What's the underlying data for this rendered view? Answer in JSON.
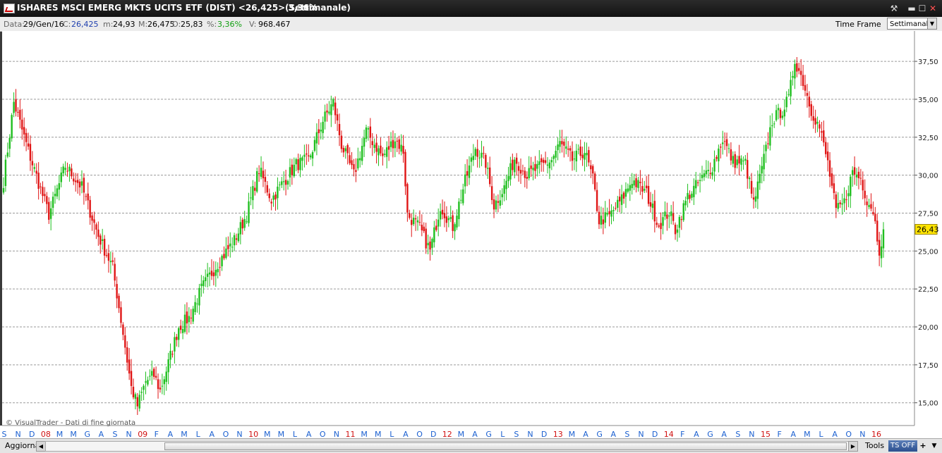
{
  "window": {
    "title": "ISHARES MSCI EMERG MKTS UCITS ETF (DIST) <26,425> 3,36%",
    "timeframe_title": "(Settimanale)",
    "buttons": {
      "tools": "⚒",
      "minimize": "▬",
      "maximize": "☐",
      "close": "✕"
    }
  },
  "info": {
    "data_label": "Data:",
    "data": "29/Gen/16",
    "close_label": "C:",
    "close": "26,425",
    "min_label": "m:",
    "min": "24,93",
    "max_label": "M:",
    "max": "26,475",
    "open_label": "O:",
    "open": "25,83",
    "pct_label": "%:",
    "pct": "3,36%",
    "vol_label": "V:",
    "vol": "968.467",
    "timeframe_label": "Time Frame",
    "timeframe_value": "Settimanale"
  },
  "colors": {
    "up": "#1fbf1f",
    "down": "#e01515",
    "background": "#ffffff",
    "grid": "#9a9a9a",
    "axis_month": "#1a5fd0",
    "axis_year": "#d01010",
    "last_label_bg": "#ffe400"
  },
  "chart_data": {
    "type": "candlestick",
    "period": "weekly",
    "ylim": [
      13.5,
      39.5
    ],
    "yticks": [
      15.0,
      17.5,
      20.0,
      22.5,
      25.0,
      27.5,
      30.0,
      32.5,
      35.0,
      37.5
    ],
    "ytick_labels": [
      "15,00",
      "17,50",
      "20,00",
      "22,50",
      "25,00",
      "27,50",
      "30,00",
      "32,50",
      "35,00",
      "37,50"
    ],
    "grid": true,
    "last_price": 26.43,
    "last_price_label": "26,43",
    "watermark": "© VisualTrader - Dati di fine giornata",
    "xticks": [
      {
        "label": "S",
        "year": false
      },
      {
        "label": "N",
        "year": false
      },
      {
        "label": "D",
        "year": false
      },
      {
        "label": "08",
        "year": true
      },
      {
        "label": "M",
        "year": false
      },
      {
        "label": "M",
        "year": false
      },
      {
        "label": "G",
        "year": false
      },
      {
        "label": "A",
        "year": false
      },
      {
        "label": "S",
        "year": false
      },
      {
        "label": "N",
        "year": false
      },
      {
        "label": "09",
        "year": true
      },
      {
        "label": "F",
        "year": false
      },
      {
        "label": "A",
        "year": false
      },
      {
        "label": "M",
        "year": false
      },
      {
        "label": "L",
        "year": false
      },
      {
        "label": "A",
        "year": false
      },
      {
        "label": "O",
        "year": false
      },
      {
        "label": "N",
        "year": false
      },
      {
        "label": "10",
        "year": true
      },
      {
        "label": "M",
        "year": false
      },
      {
        "label": "M",
        "year": false
      },
      {
        "label": "L",
        "year": false
      },
      {
        "label": "A",
        "year": false
      },
      {
        "label": "O",
        "year": false
      },
      {
        "label": "N",
        "year": false
      },
      {
        "label": "11",
        "year": true
      },
      {
        "label": "M",
        "year": false
      },
      {
        "label": "M",
        "year": false
      },
      {
        "label": "L",
        "year": false
      },
      {
        "label": "A",
        "year": false
      },
      {
        "label": "O",
        "year": false
      },
      {
        "label": "D",
        "year": false
      },
      {
        "label": "12",
        "year": true
      },
      {
        "label": "M",
        "year": false
      },
      {
        "label": "A",
        "year": false
      },
      {
        "label": "G",
        "year": false
      },
      {
        "label": "L",
        "year": false
      },
      {
        "label": "S",
        "year": false
      },
      {
        "label": "N",
        "year": false
      },
      {
        "label": "D",
        "year": false
      },
      {
        "label": "13",
        "year": true
      },
      {
        "label": "M",
        "year": false
      },
      {
        "label": "A",
        "year": false
      },
      {
        "label": "G",
        "year": false
      },
      {
        "label": "A",
        "year": false
      },
      {
        "label": "S",
        "year": false
      },
      {
        "label": "N",
        "year": false
      },
      {
        "label": "D",
        "year": false
      },
      {
        "label": "14",
        "year": true
      },
      {
        "label": "F",
        "year": false
      },
      {
        "label": "A",
        "year": false
      },
      {
        "label": "G",
        "year": false
      },
      {
        "label": "A",
        "year": false
      },
      {
        "label": "S",
        "year": false
      },
      {
        "label": "N",
        "year": false
      },
      {
        "label": "15",
        "year": true
      },
      {
        "label": "F",
        "year": false
      },
      {
        "label": "A",
        "year": false
      },
      {
        "label": "M",
        "year": false
      },
      {
        "label": "L",
        "year": false
      },
      {
        "label": "A",
        "year": false
      },
      {
        "label": "O",
        "year": false
      },
      {
        "label": "N",
        "year": false
      },
      {
        "label": "16",
        "year": true
      }
    ],
    "key_points": [
      {
        "t": 0,
        "v": 29.6
      },
      {
        "t": 5,
        "v": 34.8
      },
      {
        "t": 12,
        "v": 31.6
      },
      {
        "t": 22,
        "v": 27.4
      },
      {
        "t": 30,
        "v": 30.6
      },
      {
        "t": 38,
        "v": 29.2
      },
      {
        "t": 46,
        "v": 26.0
      },
      {
        "t": 53,
        "v": 23.9
      },
      {
        "t": 58,
        "v": 19.6
      },
      {
        "t": 62,
        "v": 16.0
      },
      {
        "t": 65,
        "v": 14.8
      },
      {
        "t": 69,
        "v": 16.4
      },
      {
        "t": 73,
        "v": 16.8
      },
      {
        "t": 76,
        "v": 15.8
      },
      {
        "t": 80,
        "v": 17.6
      },
      {
        "t": 85,
        "v": 20.0
      },
      {
        "t": 90,
        "v": 20.6
      },
      {
        "t": 96,
        "v": 22.5
      },
      {
        "t": 104,
        "v": 24.2
      },
      {
        "t": 112,
        "v": 25.7
      },
      {
        "t": 118,
        "v": 27.4
      },
      {
        "t": 124,
        "v": 30.4
      },
      {
        "t": 130,
        "v": 28.4
      },
      {
        "t": 136,
        "v": 29.6
      },
      {
        "t": 142,
        "v": 30.7
      },
      {
        "t": 148,
        "v": 31.0
      },
      {
        "t": 155,
        "v": 33.6
      },
      {
        "t": 160,
        "v": 34.8
      },
      {
        "t": 164,
        "v": 32.0
      },
      {
        "t": 170,
        "v": 30.0
      },
      {
        "t": 176,
        "v": 32.9
      },
      {
        "t": 184,
        "v": 31.2
      },
      {
        "t": 190,
        "v": 32.4
      },
      {
        "t": 194,
        "v": 31.6
      },
      {
        "t": 196,
        "v": 27.4
      },
      {
        "t": 202,
        "v": 26.5
      },
      {
        "t": 207,
        "v": 25.0
      },
      {
        "t": 212,
        "v": 28.0
      },
      {
        "t": 218,
        "v": 26.6
      },
      {
        "t": 224,
        "v": 29.6
      },
      {
        "t": 229,
        "v": 31.8
      },
      {
        "t": 234,
        "v": 30.8
      },
      {
        "t": 238,
        "v": 28.0
      },
      {
        "t": 243,
        "v": 29.2
      },
      {
        "t": 248,
        "v": 31.1
      },
      {
        "t": 254,
        "v": 30.0
      },
      {
        "t": 260,
        "v": 30.5
      },
      {
        "t": 266,
        "v": 31.0
      },
      {
        "t": 270,
        "v": 32.1
      },
      {
        "t": 276,
        "v": 31.0
      },
      {
        "t": 282,
        "v": 31.6
      },
      {
        "t": 286,
        "v": 29.7
      },
      {
        "t": 289,
        "v": 27.0
      },
      {
        "t": 294,
        "v": 27.3
      },
      {
        "t": 300,
        "v": 28.4
      },
      {
        "t": 305,
        "v": 29.7
      },
      {
        "t": 312,
        "v": 28.8
      },
      {
        "t": 318,
        "v": 26.7
      },
      {
        "t": 323,
        "v": 27.6
      },
      {
        "t": 326,
        "v": 26.4
      },
      {
        "t": 332,
        "v": 28.6
      },
      {
        "t": 338,
        "v": 29.6
      },
      {
        "t": 344,
        "v": 30.6
      },
      {
        "t": 349,
        "v": 32.4
      },
      {
        "t": 354,
        "v": 30.9
      },
      {
        "t": 360,
        "v": 30.8
      },
      {
        "t": 364,
        "v": 28.1
      },
      {
        "t": 368,
        "v": 30.4
      },
      {
        "t": 373,
        "v": 33.6
      },
      {
        "t": 378,
        "v": 34.3
      },
      {
        "t": 381,
        "v": 35.0
      },
      {
        "t": 384,
        "v": 37.6
      },
      {
        "t": 388,
        "v": 36.2
      },
      {
        "t": 392,
        "v": 34.3
      },
      {
        "t": 396,
        "v": 33.1
      },
      {
        "t": 400,
        "v": 30.8
      },
      {
        "t": 404,
        "v": 27.6
      },
      {
        "t": 408,
        "v": 28.2
      },
      {
        "t": 412,
        "v": 30.2
      },
      {
        "t": 416,
        "v": 29.8
      },
      {
        "t": 419,
        "v": 28.4
      },
      {
        "t": 422,
        "v": 27.7
      },
      {
        "t": 425,
        "v": 25.1
      },
      {
        "t": 427,
        "v": 26.4
      }
    ]
  },
  "bottombar": {
    "refresh_label": "Aggiorna",
    "scroll_left": "◀",
    "scroll_right": "▶",
    "tools_label": "Tools",
    "tsoff_label": "TS OFF",
    "plus_label": "+",
    "menu_arrow": "▼"
  }
}
